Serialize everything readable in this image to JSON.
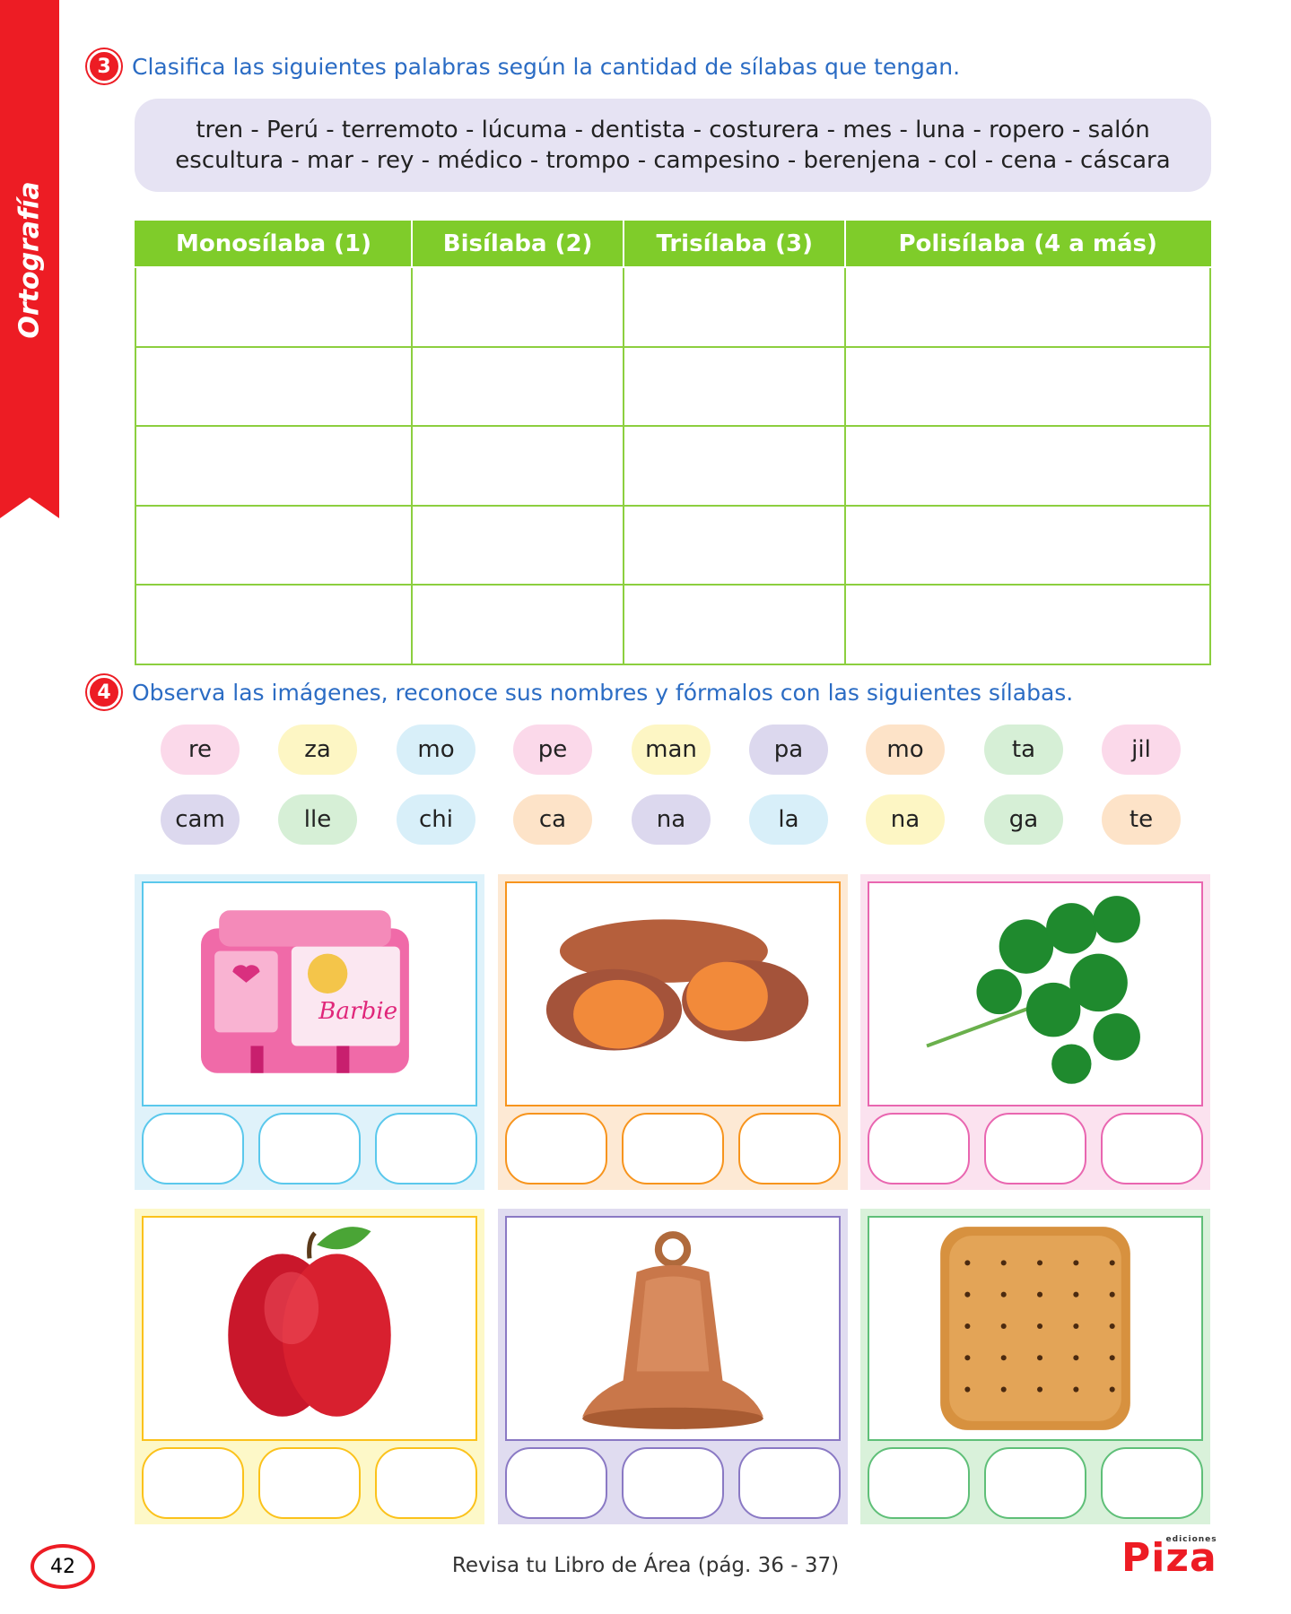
{
  "sidebar": {
    "label": "Ortografía"
  },
  "q3": {
    "number": "3",
    "text": "Clasifica las siguientes palabras según la cantidad de sílabas que tengan.",
    "words_line1": "tren - Perú - terremoto - lúcuma - dentista - costurera - mes - luna - ropero - salón",
    "words_line2": "escultura - mar - rey - médico - trompo - campesino - berenjena - col - cena - cáscara",
    "table_headers": [
      "Monosílaba (1)",
      "Bisílaba (2)",
      "Trisílaba (3)",
      "Polisílaba (4 a más)"
    ]
  },
  "q4": {
    "number": "4",
    "text": "Observa las imágenes, reconoce sus nombres y fórmalos con las siguientes sílabas.",
    "syllables_row1": [
      {
        "t": "re",
        "c": "#fbd9ea"
      },
      {
        "t": "za",
        "c": "#fdf6c4"
      },
      {
        "t": "mo",
        "c": "#d8eff9"
      },
      {
        "t": "pe",
        "c": "#fbd9ea"
      },
      {
        "t": "man",
        "c": "#fdf6c4"
      },
      {
        "t": "pa",
        "c": "#dcd8ee"
      },
      {
        "t": "mo",
        "c": "#fde3c8"
      },
      {
        "t": "ta",
        "c": "#d6efd6"
      },
      {
        "t": "jil",
        "c": "#fbd9ea"
      }
    ],
    "syllables_row2": [
      {
        "t": "cam",
        "c": "#dcd8ee"
      },
      {
        "t": "lle",
        "c": "#d6efd6"
      },
      {
        "t": "chi",
        "c": "#d8eff9"
      },
      {
        "t": "ca",
        "c": "#fde3c8"
      },
      {
        "t": "na",
        "c": "#dcd8ee"
      },
      {
        "t": "la",
        "c": "#d8eff9"
      },
      {
        "t": "na",
        "c": "#fdf6c4"
      },
      {
        "t": "ga",
        "c": "#d6efd6"
      },
      {
        "t": "te",
        "c": "#fde3c8"
      }
    ],
    "cards": [
      {
        "image": "backpack",
        "bg": "#dff2fa",
        "border": "#5ac8ec",
        "brand_text": "Barbie"
      },
      {
        "image": "sweet-potato",
        "bg": "#fde9d4",
        "border": "#f7941d"
      },
      {
        "image": "cilantro",
        "bg": "#fbe2ef",
        "border": "#e966b0"
      },
      {
        "image": "apple",
        "bg": "#fdf8c8",
        "border": "#fbc21b"
      },
      {
        "image": "bell",
        "bg": "#e0dcf0",
        "border": "#8a79c4"
      },
      {
        "image": "cracker",
        "bg": "#d9f1da",
        "border": "#5fbf78"
      }
    ]
  },
  "footer": {
    "page": "42",
    "text": "Revisa tu Libro de Área (pág. 36 - 37)",
    "logo": "Piza",
    "logo_small": "ediciones"
  }
}
